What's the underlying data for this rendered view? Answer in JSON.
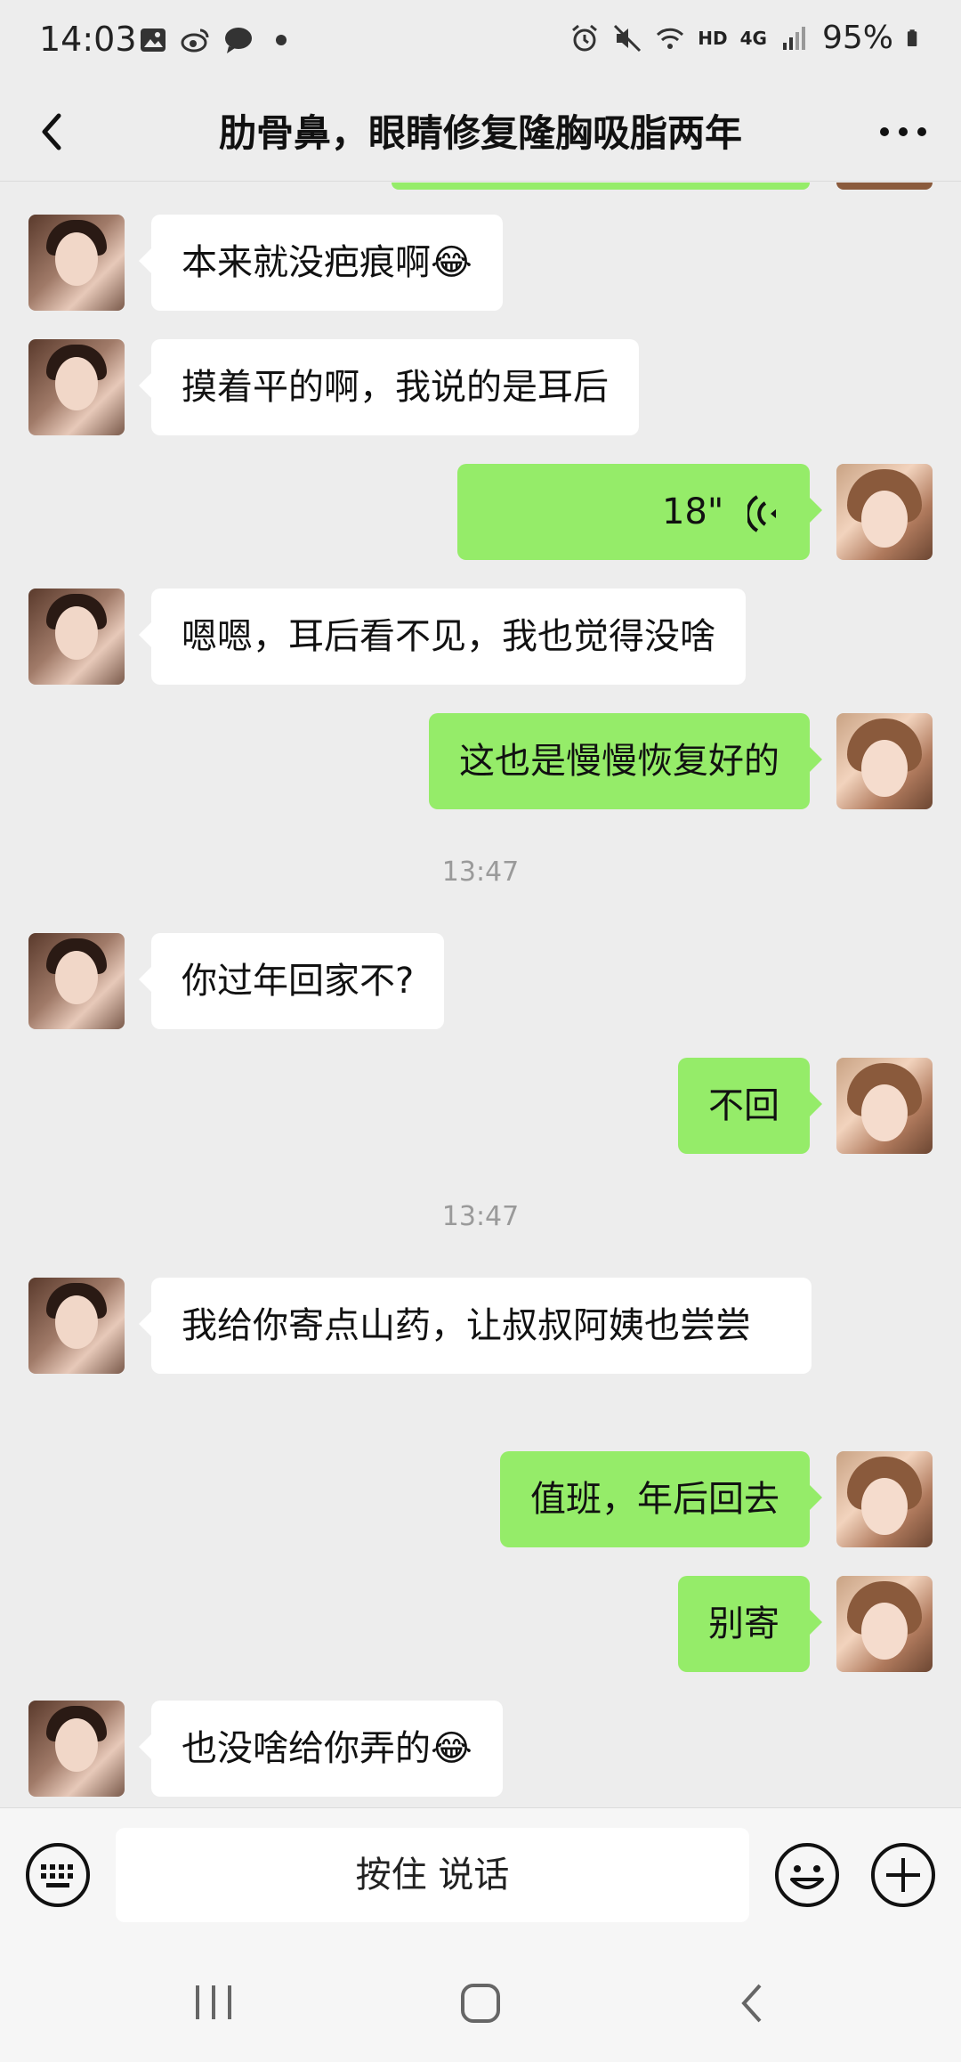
{
  "status_bar": {
    "time": "14:03",
    "battery": "95%",
    "network": "4G",
    "hd": "HD"
  },
  "nav": {
    "title": "肋骨鼻，眼睛修复隆胸吸脂两年"
  },
  "messages": [
    {
      "side": "left",
      "text": "本来就没疤痕啊😂"
    },
    {
      "side": "left",
      "text": "摸着平的啊，我说的是耳后"
    },
    {
      "side": "right",
      "type": "voice",
      "text": "18\""
    },
    {
      "side": "left",
      "text": "嗯嗯，耳后看不见，我也觉得没啥"
    },
    {
      "side": "right",
      "text": "这也是慢慢恢复好的"
    },
    {
      "type": "time",
      "text": "13:47"
    },
    {
      "side": "left",
      "text": "你过年回家不?"
    },
    {
      "side": "right",
      "text": "不回"
    },
    {
      "type": "time",
      "text": "13:47"
    },
    {
      "side": "left",
      "text": "我给你寄点山药，让叔叔阿姨也尝尝"
    },
    {
      "side": "right",
      "text": "值班，年后回去"
    },
    {
      "side": "right",
      "text": "别寄"
    },
    {
      "side": "left",
      "text": "也没啥给你弄的😂"
    }
  ],
  "input": {
    "talk_label": "按住 说话"
  },
  "colors": {
    "background": "#ededed",
    "sent_bubble": "#95ec69",
    "received_bubble": "#ffffff"
  }
}
